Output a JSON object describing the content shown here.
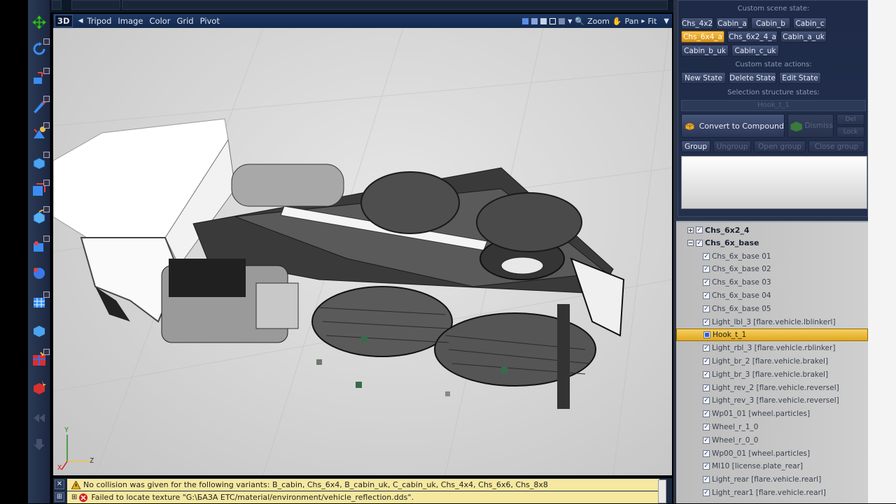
{
  "viewport": {
    "mode_label": "3D",
    "menus": [
      "Tripod",
      "Image",
      "Color",
      "Grid",
      "Pivot"
    ],
    "zoom_label": "Zoom",
    "pan_label": "Pan",
    "fit_label": "Fit",
    "axis": {
      "y": "Y",
      "z": "Z",
      "x": "X"
    }
  },
  "scene_state": {
    "title": "Custom scene state:",
    "states": [
      "Chs_4x2",
      "Cabin_a",
      "Cabin_b",
      "Cabin_c",
      "Chs_6x4_a",
      "Chs_6x2_4_a",
      "Cabin_a_uk",
      "Cabin_b_uk",
      "Cabin_c_uk"
    ],
    "active_state": "Chs_6x4_a",
    "actions_title": "Custom state actions:",
    "new_state": "New State",
    "delete_state": "Delete State",
    "edit_state": "Edit State",
    "structure_title": "Selection structure states:",
    "structure_value": "Hook_t_1",
    "convert_label": "Convert to Compound",
    "dismiss_label": "Dismiss",
    "del_label": "Del",
    "lock_label": "Lock",
    "group_label": "Group",
    "ungroup_label": "Ungroup",
    "open_group_label": "Open group",
    "close_group_label": "Close group"
  },
  "tree": {
    "items": [
      {
        "label": "Chs_6x2_4",
        "level": 0,
        "expand": "+",
        "bold": true
      },
      {
        "label": "Chs_6x_base",
        "level": 0,
        "expand": "−",
        "bold": true
      },
      {
        "label": "Chs_6x_base 01",
        "level": 1
      },
      {
        "label": "Chs_6x_base 02",
        "level": 1
      },
      {
        "label": "Chs_6x_base 03",
        "level": 1
      },
      {
        "label": "Chs_6x_base 04",
        "level": 1
      },
      {
        "label": "Chs_6x_base 05",
        "level": 1
      },
      {
        "label": "Light_lbl_3 [flare.vehicle.lblinkerl]",
        "level": 1
      },
      {
        "label": "Hook_t_1",
        "level": 1,
        "selected": true
      },
      {
        "label": "Light_rbl_3 [flare.vehicle.rblinker]",
        "level": 1
      },
      {
        "label": "Light_br_2 [flare.vehicle.brakel]",
        "level": 1
      },
      {
        "label": "Light_br_3 [flare.vehicle.brakel]",
        "level": 1
      },
      {
        "label": "Light_rev_2 [flare.vehicle.reversel]",
        "level": 1
      },
      {
        "label": "Light_rev_3 [flare.vehicle.reversel]",
        "level": 1
      },
      {
        "label": "Wp01_01 [wheel.particles]",
        "level": 1
      },
      {
        "label": "Wheel_r_1_0",
        "level": 1
      },
      {
        "label": "Wheel_r_0_0",
        "level": 1
      },
      {
        "label": "Wp00_01 [wheel.particles]",
        "level": 1
      },
      {
        "label": "Ml10 [license.plate_rear]",
        "level": 1
      },
      {
        "label": "Light_rear [flare.vehicle.rearl]",
        "level": 1
      },
      {
        "label": "Light_rear1 [flare.vehicle.rearl]",
        "level": 1
      }
    ]
  },
  "messages": [
    {
      "type": "warning",
      "text": "No collision was given for the following variants: B_cabin, Chs_6x4, B_cabin_uk, C_cabin_uk, Chs_4x4, Chs_6x6, Chs_8x8"
    },
    {
      "type": "error",
      "text": "Failed to locate texture \"G:\\БАЗА ETC/material/environment/vehicle_reflection.dds\"."
    }
  ],
  "colors": {
    "accent": "#e0a820",
    "panel": "#22304e",
    "header": "#1f3a66"
  }
}
